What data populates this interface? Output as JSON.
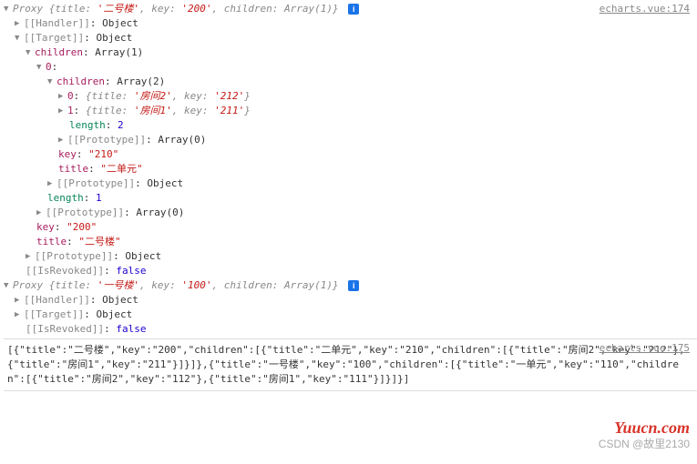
{
  "source1": "echarts.vue:174",
  "source2": "echarts.vue:175",
  "info_glyph": "i",
  "proxy1": {
    "header_prefix": "Proxy ",
    "preview_title_k": "title: ",
    "preview_title_v": "'二号楼'",
    "preview_key_k": "key: ",
    "preview_key_v": "'200'",
    "preview_children_k": "children: ",
    "preview_children_v": "Array(1)",
    "handler_k": "[[Handler]]",
    "handler_v": "Object",
    "target_k": "[[Target]]",
    "target_v": "Object",
    "children_k": "children",
    "children_v": "Array(1)",
    "idx0_k": "0",
    "l2_children_k": "children",
    "l2_children_v": "Array(2)",
    "l3_0_k": "0",
    "l3_0_title_k": "title: ",
    "l3_0_title_v": "'房间2'",
    "l3_0_key_k": "key: ",
    "l3_0_key_v": "'212'",
    "l3_1_k": "1",
    "l3_1_title_k": "title: ",
    "l3_1_title_v": "'房间1'",
    "l3_1_key_k": "key: ",
    "l3_1_key_v": "'211'",
    "l3_length_k": "length",
    "l3_length_v": "2",
    "l3_proto_k": "[[Prototype]]",
    "l3_proto_v": "Array(0)",
    "l2_key_k": "key",
    "l2_key_v": "\"210\"",
    "l2_title_k": "title",
    "l2_title_v": "\"二单元\"",
    "l2_proto_k": "[[Prototype]]",
    "l2_proto_v": "Object",
    "l1_length_k": "length",
    "l1_length_v": "1",
    "l1_proto_k": "[[Prototype]]",
    "l1_proto_v": "Array(0)",
    "t_key_k": "key",
    "t_key_v": "\"200\"",
    "t_title_k": "title",
    "t_title_v": "\"二号楼\"",
    "t_proto_k": "[[Prototype]]",
    "t_proto_v": "Object",
    "isrevoked_k": "[[IsRevoked]]",
    "isrevoked_v": "false"
  },
  "proxy2": {
    "header_prefix": "Proxy ",
    "preview_title_k": "title: ",
    "preview_title_v": "'一号楼'",
    "preview_key_k": "key: ",
    "preview_key_v": "'100'",
    "preview_children_k": "children: ",
    "preview_children_v": "Array(1)",
    "handler_k": "[[Handler]]",
    "handler_v": "Object",
    "target_k": "[[Target]]",
    "target_v": "Object",
    "isrevoked_k": "[[IsRevoked]]",
    "isrevoked_v": "false"
  },
  "json_dump": "[{\"title\":\"二号楼\",\"key\":\"200\",\"children\":[{\"title\":\"二单元\",\"key\":\"210\",\"children\":[{\"title\":\"房间2\",\"key\":\"212\"},{\"title\":\"房间1\",\"key\":\"211\"}]}]},{\"title\":\"一号楼\",\"key\":\"100\",\"children\":[{\"title\":\"一单元\",\"key\":\"110\",\"children\":[{\"title\":\"房间2\",\"key\":\"112\"},{\"title\":\"房间1\",\"key\":\"111\"}]}]}]",
  "brand": "Yuucn.com",
  "csdn": "CSDN @故里2130"
}
